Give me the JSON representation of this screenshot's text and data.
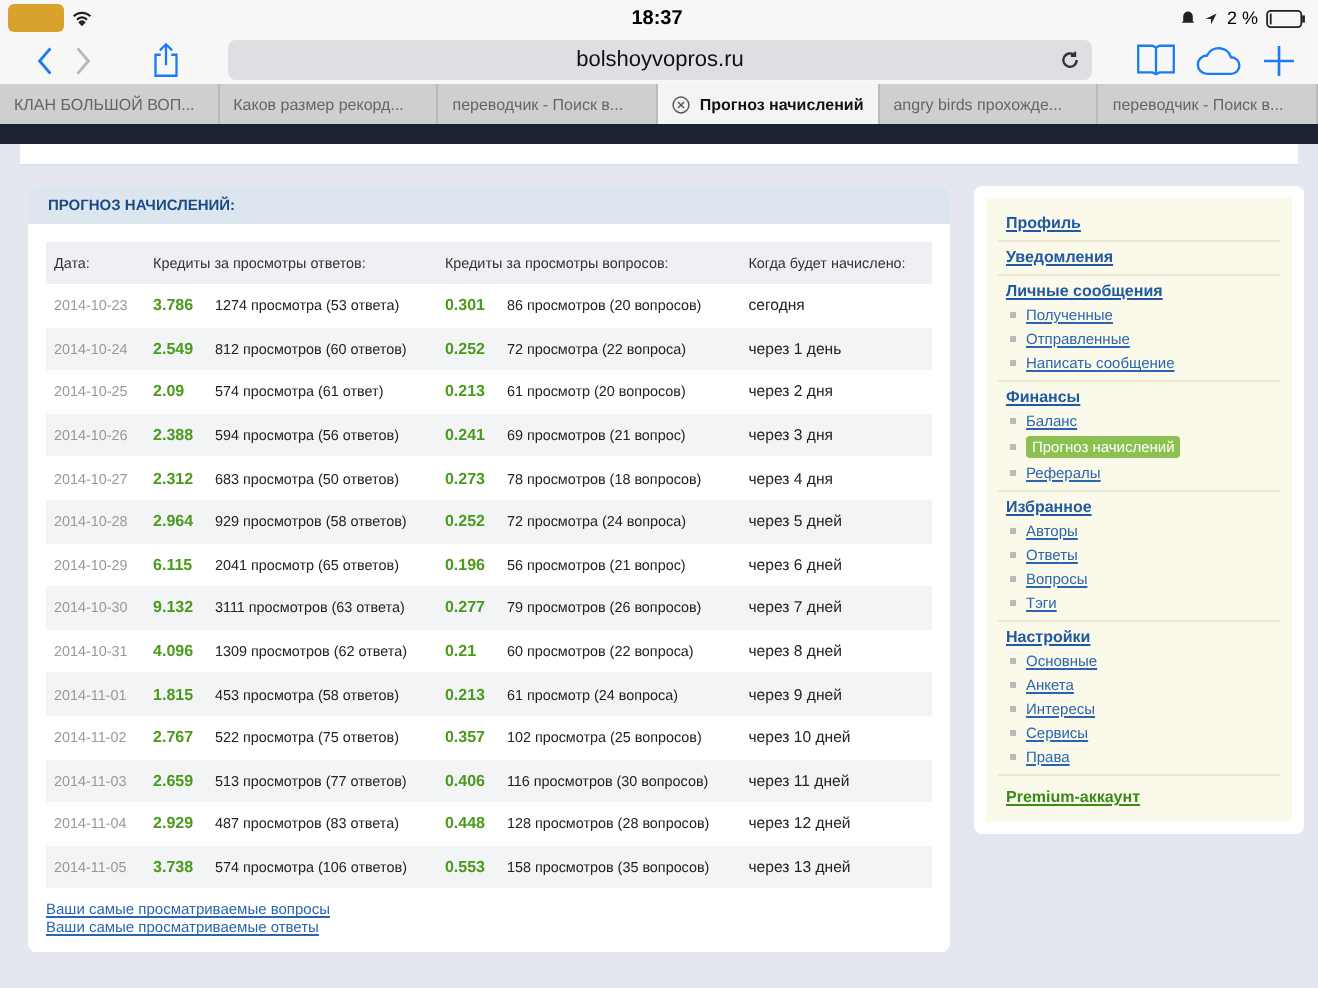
{
  "status_bar": {
    "time": "18:37",
    "battery_text": "2 %"
  },
  "toolbar": {
    "address": "bolshoyvopros.ru"
  },
  "tabs": [
    {
      "label": "КЛАН БОЛЬШОЙ ВОП...",
      "selected": false
    },
    {
      "label": "Каков размер рекорд...",
      "selected": false
    },
    {
      "label": "переводчик - Поиск в...",
      "selected": false
    },
    {
      "label": "Прогноз начислений",
      "selected": true
    },
    {
      "label": "angry birds прохожде...",
      "selected": false
    },
    {
      "label": "переводчик - Поиск в...",
      "selected": false
    }
  ],
  "main": {
    "title": "ПРОГНОЗ НАЧИСЛЕНИЙ:",
    "columns": [
      "Дата:",
      "Кредиты за просмотры ответов:",
      "Кредиты за просмотры вопросов:",
      "Когда будет начислено:"
    ],
    "rows": [
      {
        "date": "2014-10-23",
        "answer_credits": "3.786",
        "answer_views": "1274 просмотра (53 ответа)",
        "question_credits": "0.301",
        "question_views": "86 просмотров (20 вопросов)",
        "when": "сегодня"
      },
      {
        "date": "2014-10-24",
        "answer_credits": "2.549",
        "answer_views": "812 просмотров (60 ответов)",
        "question_credits": "0.252",
        "question_views": "72 просмотра (22 вопроса)",
        "when": "через 1 день"
      },
      {
        "date": "2014-10-25",
        "answer_credits": "2.09",
        "answer_views": "574 просмотра (61 ответ)",
        "question_credits": "0.213",
        "question_views": "61 просмотр (20 вопросов)",
        "when": "через 2 дня"
      },
      {
        "date": "2014-10-26",
        "answer_credits": "2.388",
        "answer_views": "594 просмотра (56 ответов)",
        "question_credits": "0.241",
        "question_views": "69 просмотров (21 вопрос)",
        "when": "через 3 дня"
      },
      {
        "date": "2014-10-27",
        "answer_credits": "2.312",
        "answer_views": "683 просмотра (50 ответов)",
        "question_credits": "0.273",
        "question_views": "78 просмотров (18 вопросов)",
        "when": "через 4 дня"
      },
      {
        "date": "2014-10-28",
        "answer_credits": "2.964",
        "answer_views": "929 просмотров (58 ответов)",
        "question_credits": "0.252",
        "question_views": "72 просмотра (24 вопроса)",
        "when": "через 5 дней"
      },
      {
        "date": "2014-10-29",
        "answer_credits": "6.115",
        "answer_views": "2041 просмотр (65 ответов)",
        "question_credits": "0.196",
        "question_views": "56 просмотров (21 вопрос)",
        "when": "через 6 дней"
      },
      {
        "date": "2014-10-30",
        "answer_credits": "9.132",
        "answer_views": "3111 просмотров (63 ответа)",
        "question_credits": "0.277",
        "question_views": "79 просмотров (26 вопросов)",
        "when": "через 7 дней"
      },
      {
        "date": "2014-10-31",
        "answer_credits": "4.096",
        "answer_views": "1309 просмотров (62 ответа)",
        "question_credits": "0.21",
        "question_views": "60 просмотров (22 вопроса)",
        "when": "через 8 дней"
      },
      {
        "date": "2014-11-01",
        "answer_credits": "1.815",
        "answer_views": "453 просмотра (58 ответов)",
        "question_credits": "0.213",
        "question_views": "61 просмотр (24 вопроса)",
        "when": "через 9 дней"
      },
      {
        "date": "2014-11-02",
        "answer_credits": "2.767",
        "answer_views": "522 просмотра (75 ответов)",
        "question_credits": "0.357",
        "question_views": "102 просмотра (25 вопросов)",
        "when": "через 10 дней"
      },
      {
        "date": "2014-11-03",
        "answer_credits": "2.659",
        "answer_views": "513 просмотров (77 ответов)",
        "question_credits": "0.406",
        "question_views": "116 просмотров (30 вопросов)",
        "when": "через 11 дней"
      },
      {
        "date": "2014-11-04",
        "answer_credits": "2.929",
        "answer_views": "487 просмотров (83 ответа)",
        "question_credits": "0.448",
        "question_views": "128 просмотров (28 вопросов)",
        "when": "через 12 дней"
      },
      {
        "date": "2014-11-05",
        "answer_credits": "3.738",
        "answer_views": "574 просмотра (106 ответов)",
        "question_credits": "0.553",
        "question_views": "158 просмотров (35 вопросов)",
        "when": "через 13 дней"
      }
    ],
    "links": [
      "Ваши самые просматриваемые вопросы",
      "Ваши самые просматриваемые ответы"
    ]
  },
  "sidebar": {
    "sections": [
      {
        "title": "Профиль"
      },
      {
        "title": "Уведомления"
      },
      {
        "title": "Личные сообщения",
        "items": [
          {
            "label": "Полученные",
            "selected": false
          },
          {
            "label": "Отправленные",
            "selected": false
          },
          {
            "label": "Написать сообщение",
            "selected": false
          }
        ]
      },
      {
        "title": "Финансы",
        "items": [
          {
            "label": "Баланс",
            "selected": false
          },
          {
            "label": "Прогноз начислений",
            "selected": true
          },
          {
            "label": "Рефералы",
            "selected": false
          }
        ]
      },
      {
        "title": "Избранное",
        "items": [
          {
            "label": "Авторы",
            "selected": false
          },
          {
            "label": "Ответы",
            "selected": false
          },
          {
            "label": "Вопросы",
            "selected": false
          },
          {
            "label": "Тэги",
            "selected": false
          }
        ]
      },
      {
        "title": "Настройки",
        "items": [
          {
            "label": "Основные",
            "selected": false
          },
          {
            "label": "Анкета",
            "selected": false
          },
          {
            "label": "Интересы",
            "selected": false
          },
          {
            "label": "Сервисы",
            "selected": false
          },
          {
            "label": "Права",
            "selected": false
          }
        ]
      }
    ],
    "premium_link": "Premium-аккаунт"
  }
}
